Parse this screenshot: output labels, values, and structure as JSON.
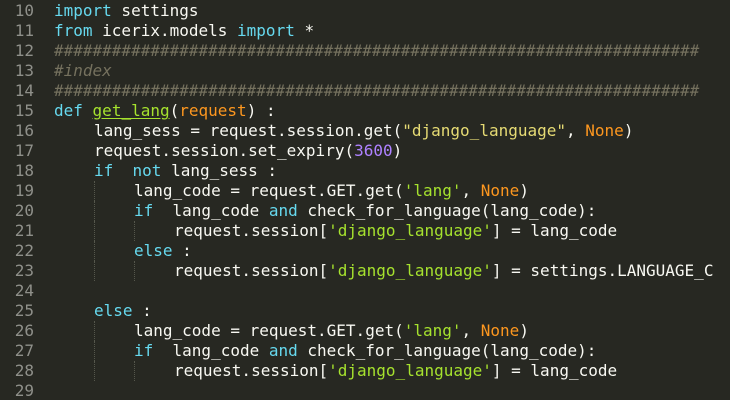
{
  "editor": {
    "colors": {
      "background": "#272822",
      "text": "#f8f8f2",
      "keyword": "#66d9ef",
      "param": "#fd971f",
      "string": "#e6db74",
      "number": "#ae81ff",
      "comment": "#75715e",
      "function": "#a6e22e"
    },
    "lines": [
      {
        "num": "10",
        "indent": 0,
        "tokens": [
          {
            "t": "import",
            "c": "kw"
          },
          {
            "t": " settings",
            "c": "plain"
          }
        ]
      },
      {
        "num": "11",
        "indent": 0,
        "tokens": [
          {
            "t": "from",
            "c": "kw"
          },
          {
            "t": " icerix.models ",
            "c": "plain"
          },
          {
            "t": "import",
            "c": "kw"
          },
          {
            "t": " *",
            "c": "plain"
          }
        ]
      },
      {
        "num": "12",
        "indent": 0,
        "tokens": [
          {
            "t": "###################################################################",
            "c": "cmt"
          }
        ]
      },
      {
        "num": "13",
        "indent": 0,
        "tokens": [
          {
            "t": "#index",
            "c": "cmt"
          }
        ]
      },
      {
        "num": "14",
        "indent": 0,
        "tokens": [
          {
            "t": "###################################################################",
            "c": "cmt"
          }
        ]
      },
      {
        "num": "15",
        "indent": 0,
        "tokens": [
          {
            "t": "def",
            "c": "kw"
          },
          {
            "t": " ",
            "c": "plain"
          },
          {
            "t": "get_lang",
            "c": "fn"
          },
          {
            "t": "(",
            "c": "plain"
          },
          {
            "t": "request",
            "c": "param"
          },
          {
            "t": ") :",
            "c": "plain"
          }
        ]
      },
      {
        "num": "16",
        "indent": 1,
        "tokens": [
          {
            "t": "lang_sess = request.session.get(",
            "c": "plain"
          },
          {
            "t": "\"django_language\"",
            "c": "str"
          },
          {
            "t": ", ",
            "c": "plain"
          },
          {
            "t": "None",
            "c": "const"
          },
          {
            "t": ")",
            "c": "plain"
          }
        ]
      },
      {
        "num": "17",
        "indent": 1,
        "tokens": [
          {
            "t": "request.session.set_expiry(",
            "c": "plain"
          },
          {
            "t": "3600",
            "c": "num"
          },
          {
            "t": ")",
            "c": "plain"
          }
        ]
      },
      {
        "num": "18",
        "indent": 1,
        "tokens": [
          {
            "t": "if",
            "c": "kw"
          },
          {
            "t": "  ",
            "c": "plain"
          },
          {
            "t": "not",
            "c": "kw"
          },
          {
            "t": " lang_sess :",
            "c": "plain"
          }
        ]
      },
      {
        "num": "19",
        "indent": 2,
        "tokens": [
          {
            "t": "lang_code = request.GET.get(",
            "c": "plain"
          },
          {
            "t": "'lang'",
            "c": "str2"
          },
          {
            "t": ", ",
            "c": "plain"
          },
          {
            "t": "None",
            "c": "const"
          },
          {
            "t": ")",
            "c": "plain"
          }
        ]
      },
      {
        "num": "20",
        "indent": 2,
        "tokens": [
          {
            "t": "if",
            "c": "kw"
          },
          {
            "t": "  lang_code ",
            "c": "plain"
          },
          {
            "t": "and",
            "c": "kw"
          },
          {
            "t": " check_for_language(lang_code):",
            "c": "plain"
          }
        ]
      },
      {
        "num": "21",
        "indent": 3,
        "tokens": [
          {
            "t": "request.session[",
            "c": "plain"
          },
          {
            "t": "'django_language'",
            "c": "str2"
          },
          {
            "t": "] = lang_code",
            "c": "plain"
          }
        ]
      },
      {
        "num": "22",
        "indent": 2,
        "tokens": [
          {
            "t": "else",
            "c": "kw"
          },
          {
            "t": " :",
            "c": "plain"
          }
        ]
      },
      {
        "num": "23",
        "indent": 3,
        "tokens": [
          {
            "t": "request.session[",
            "c": "plain"
          },
          {
            "t": "'django_language'",
            "c": "str2"
          },
          {
            "t": "] = settings.LANGUAGE_C",
            "c": "plain"
          }
        ]
      },
      {
        "num": "24",
        "indent": 0,
        "tokens": []
      },
      {
        "num": "25",
        "indent": 1,
        "tokens": [
          {
            "t": "else",
            "c": "kw"
          },
          {
            "t": " :",
            "c": "plain"
          }
        ]
      },
      {
        "num": "26",
        "indent": 2,
        "tokens": [
          {
            "t": "lang_code = request.GET.get(",
            "c": "plain"
          },
          {
            "t": "'lang'",
            "c": "str2"
          },
          {
            "t": ", ",
            "c": "plain"
          },
          {
            "t": "None",
            "c": "const"
          },
          {
            "t": ")",
            "c": "plain"
          }
        ]
      },
      {
        "num": "27",
        "indent": 2,
        "tokens": [
          {
            "t": "if",
            "c": "kw"
          },
          {
            "t": "  lang_code ",
            "c": "plain"
          },
          {
            "t": "and",
            "c": "kw"
          },
          {
            "t": " check_for_language(lang_code):",
            "c": "plain"
          }
        ]
      },
      {
        "num": "28",
        "indent": 3,
        "tokens": [
          {
            "t": "request.session[",
            "c": "plain"
          },
          {
            "t": "'django_language'",
            "c": "str2"
          },
          {
            "t": "] = lang_code",
            "c": "plain"
          }
        ]
      },
      {
        "num": "29",
        "indent": 0,
        "tokens": []
      }
    ]
  }
}
